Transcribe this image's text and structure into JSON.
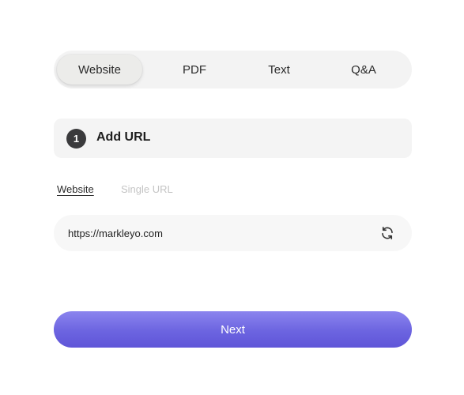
{
  "source_tabs": {
    "items": [
      {
        "label": "Website",
        "active": true
      },
      {
        "label": "PDF",
        "active": false
      },
      {
        "label": "Text",
        "active": false
      },
      {
        "label": "Q&A",
        "active": false
      }
    ]
  },
  "step": {
    "number": "1",
    "title": "Add URL"
  },
  "url_mode_tabs": {
    "items": [
      {
        "label": "Website",
        "active": true
      },
      {
        "label": "Single URL",
        "active": false
      }
    ]
  },
  "url_field": {
    "value": "https://markleyo.com",
    "icon": "refresh-icon"
  },
  "actions": {
    "next_label": "Next"
  },
  "colors": {
    "accent": "#6c64e0",
    "step_badge": "#3a3a3c",
    "card_background": "#f4f4f4"
  }
}
